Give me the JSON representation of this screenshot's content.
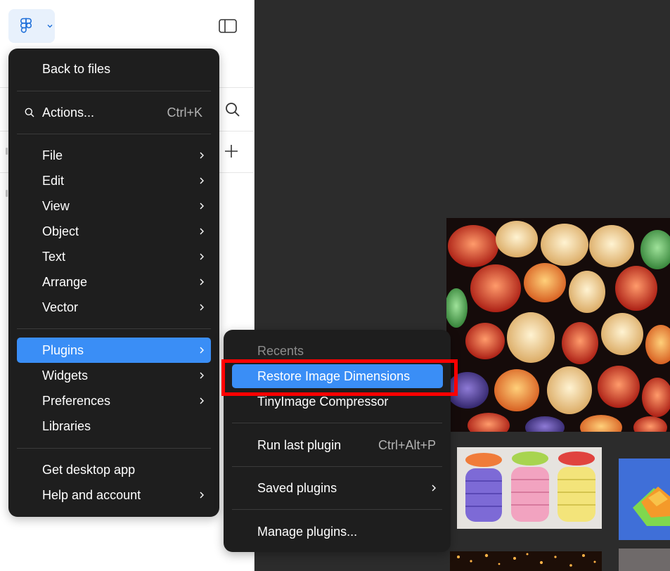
{
  "main_menu": {
    "back": "Back to files",
    "actions": {
      "label": "Actions...",
      "shortcut": "Ctrl+K"
    },
    "items": [
      {
        "label": "File"
      },
      {
        "label": "Edit"
      },
      {
        "label": "View"
      },
      {
        "label": "Object"
      },
      {
        "label": "Text"
      },
      {
        "label": "Arrange"
      },
      {
        "label": "Vector"
      },
      {
        "label": "Plugins"
      },
      {
        "label": "Widgets"
      },
      {
        "label": "Preferences"
      },
      {
        "label": "Libraries"
      },
      {
        "label": "Get desktop app"
      },
      {
        "label": "Help and account"
      }
    ]
  },
  "plugins_menu": {
    "recents_header": "Recents",
    "recent_items": [
      "Restore Image Dimensions",
      "TinyImage Compressor"
    ],
    "run_last": {
      "label": "Run last plugin",
      "shortcut": "Ctrl+Alt+P"
    },
    "saved": "Saved plugins",
    "manage": "Manage plugins..."
  },
  "icons": {
    "logo": "figma-logo-icon",
    "sidebar_toggle": "sidebar-toggle-icon",
    "search": "search-icon",
    "add": "plus-icon",
    "submenu": "chevron-right-icon"
  },
  "colors": {
    "menu_bg": "#1e1e1e",
    "accent": "#3a8ef6",
    "canvas": "#2c2c2c",
    "highlight": "#ff0000"
  }
}
